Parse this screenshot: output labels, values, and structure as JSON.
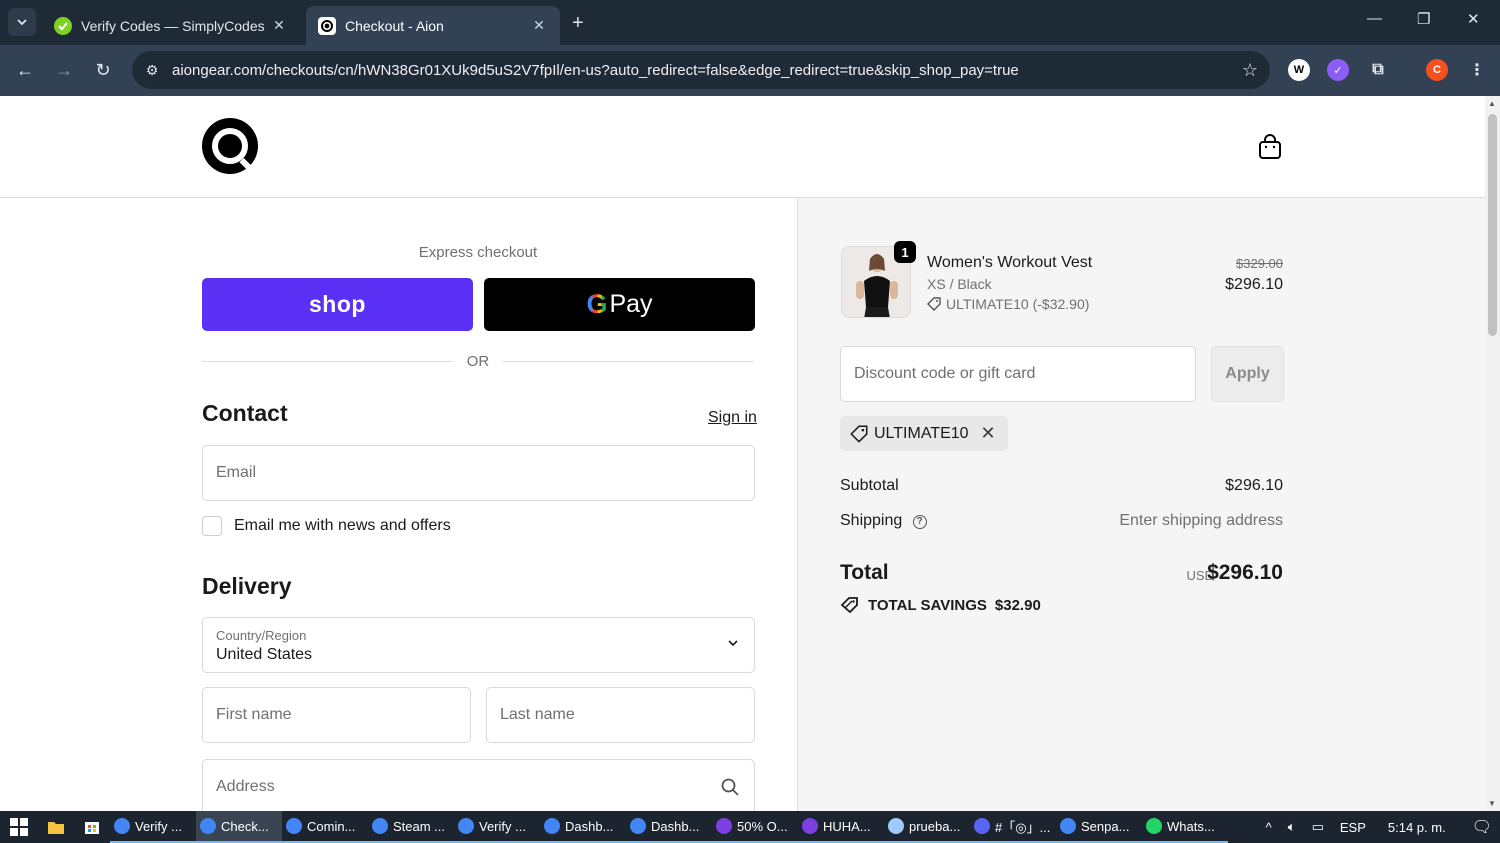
{
  "browser": {
    "tabs": [
      {
        "title": "Verify Codes — SimplyCodes",
        "active": false
      },
      {
        "title": "Checkout - Aion",
        "active": true
      }
    ],
    "url": "aiongear.com/checkouts/cn/hWN38Gr01XUk9d5uS2V7fpIl/en-us?auto_redirect=false&edge_redirect=true&skip_shop_pay=true",
    "profile_initial": "C"
  },
  "checkout": {
    "express_label": "Express checkout",
    "shop_pay_label": "shop",
    "gpay_label": "Pay",
    "or_label": "OR",
    "contact": {
      "title": "Contact",
      "signin_label": "Sign in",
      "email_placeholder": "Email",
      "newsletter_label": "Email me with news and offers"
    },
    "delivery": {
      "title": "Delivery",
      "country_label": "Country/Region",
      "country_value": "United States",
      "first_name_placeholder": "First name",
      "last_name_placeholder": "Last name",
      "address_placeholder": "Address"
    }
  },
  "summary": {
    "product": {
      "name": "Women's Workout Vest",
      "variant": "XS / Black",
      "discount_note": "ULTIMATE10 (-$32.90)",
      "quantity": "1",
      "compare_price": "$329.00",
      "price": "$296.10"
    },
    "discount_placeholder": "Discount code or gift card",
    "apply_label": "Apply",
    "applied_code": "ULTIMATE10",
    "subtotal_label": "Subtotal",
    "subtotal_value": "$296.10",
    "shipping_label": "Shipping",
    "shipping_value": "Enter shipping address",
    "total_label": "Total",
    "currency": "USD",
    "total_value": "$296.10",
    "savings_label": "TOTAL SAVINGS",
    "savings_value": "$32.90"
  },
  "taskbar": {
    "apps": [
      {
        "label": "Verify ...",
        "color": "#4285f4"
      },
      {
        "label": "Check...",
        "color": "#4285f4",
        "active": true
      },
      {
        "label": "Comin...",
        "color": "#4285f4"
      },
      {
        "label": "Steam ...",
        "color": "#4285f4"
      },
      {
        "label": "Verify ...",
        "color": "#4285f4"
      },
      {
        "label": "Dashb...",
        "color": "#4285f4"
      },
      {
        "label": "Dashb...",
        "color": "#4285f4"
      },
      {
        "label": "50% O...",
        "color": "#7b3fe4"
      },
      {
        "label": "HUHA...",
        "color": "#7b3fe4"
      },
      {
        "label": "prueba...",
        "color": "#9ecbff"
      },
      {
        "label": "#「◎」...",
        "color": "#5865f2"
      },
      {
        "label": "Senpa...",
        "color": "#4285f4"
      },
      {
        "label": "Whats...",
        "color": "#25d366"
      }
    ],
    "language": "ESP",
    "time": "5:14 p. m."
  }
}
